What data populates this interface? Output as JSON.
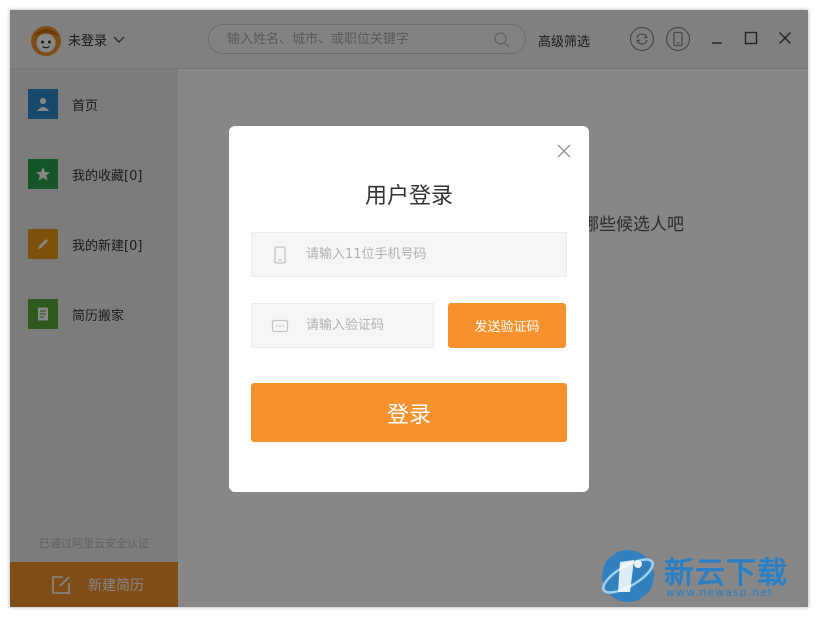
{
  "header": {
    "user_status": "未登录",
    "search_placeholder": "输入姓名、城市、或职位关键字",
    "advanced_filter": "高级筛选"
  },
  "sidebar": {
    "items": [
      {
        "label": "首页",
        "color": "#2f8ac8",
        "icon": "user-icon"
      },
      {
        "label": "我的收藏[0]",
        "color": "#27a34a",
        "icon": "star-icon"
      },
      {
        "label": "我的新建[0]",
        "color": "#eb9a14",
        "icon": "pencil-icon"
      },
      {
        "label": "简历搬家",
        "color": "#5aaa3a",
        "icon": "document-icon"
      }
    ],
    "verified_text": "已通过阿里云安全认证",
    "new_resume_label": "新建简历"
  },
  "content": {
    "hint_visible": "哪些候选人吧"
  },
  "login_modal": {
    "title": "用户登录",
    "phone_placeholder": "请输入11位手机号码",
    "code_placeholder": "请输入验证码",
    "send_code_label": "发送验证码",
    "login_label": "登录"
  },
  "watermark": {
    "name": "新云下载",
    "url": "www.newasp.net"
  },
  "colors": {
    "accent": "#f7912e",
    "watermark": "#2a7fc4"
  }
}
